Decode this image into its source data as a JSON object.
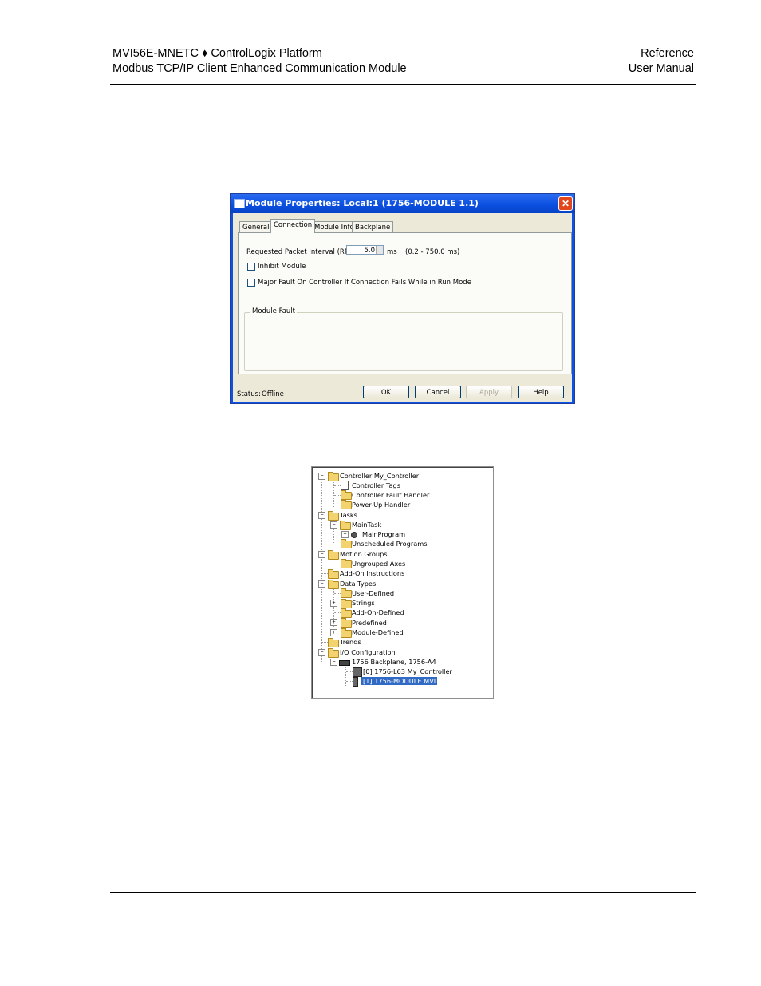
{
  "header": {
    "left_line1": "MVI56E-MNETC ♦ ControlLogix Platform",
    "left_line2": "Modbus TCP/IP Client Enhanced Communication Module",
    "right_line1": "Reference",
    "right_line2": "User Manual"
  },
  "dialog": {
    "title": "Module Properties: Local:1 (1756-MODULE 1.1)",
    "close_glyph": "✕",
    "tabs": [
      "General",
      "Connection",
      "Module Info",
      "Backplane"
    ],
    "active_tab": "Connection",
    "rpi_label": "Requested Packet Interval (RPI):",
    "rpi_value": "5.0",
    "rpi_unit": "ms",
    "rpi_range": "(0.2 - 750.0 ms)",
    "inhibit_label": "Inhibit Module",
    "major_fault_label": "Major Fault On Controller If Connection Fails While in Run Mode",
    "module_fault_label": "Module Fault",
    "status_label": "Status:",
    "status_value": "Offline",
    "buttons": {
      "ok": "OK",
      "cancel": "Cancel",
      "apply": "Apply",
      "help": "Help"
    }
  },
  "tree": {
    "expanders": {
      "collapse": "−",
      "expand": "+"
    },
    "controller": "Controller My_Controller",
    "controller_tags": "Controller Tags",
    "controller_fault_handler": "Controller Fault Handler",
    "power_up_handler": "Power-Up Handler",
    "tasks": "Tasks",
    "main_task": "MainTask",
    "main_program": "MainProgram",
    "unscheduled_programs": "Unscheduled Programs",
    "motion_groups": "Motion Groups",
    "ungrouped_axes": "Ungrouped Axes",
    "add_on_instructions": "Add-On Instructions",
    "data_types": "Data Types",
    "user_defined": "User-Defined",
    "strings": "Strings",
    "add_on_defined": "Add-On-Defined",
    "predefined": "Predefined",
    "module_defined": "Module-Defined",
    "trends": "Trends",
    "io_configuration": "I/O Configuration",
    "backplane": "1756 Backplane, 1756-A4",
    "slot0": "[0] 1756-L63 My_Controller",
    "slot1": "[1] 1756-MODULE MVI"
  }
}
